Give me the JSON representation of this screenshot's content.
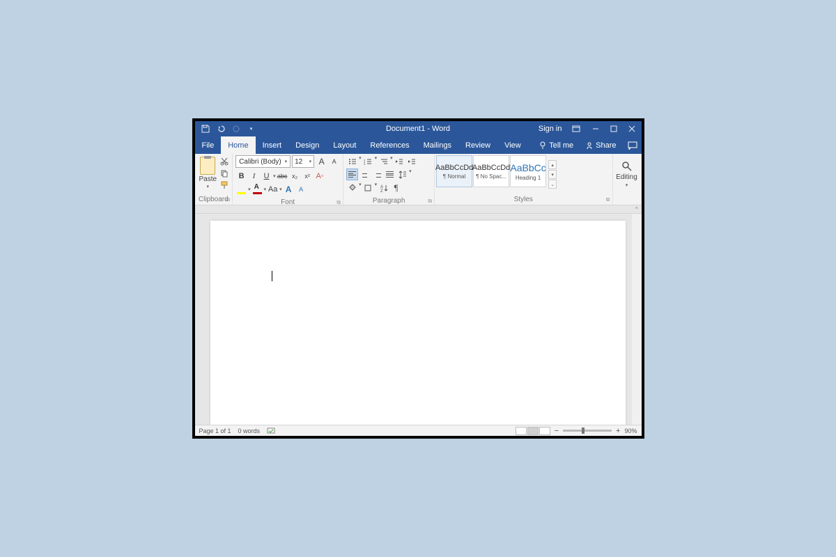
{
  "title": "Document1 - Word",
  "signin": "Sign in",
  "tabs": {
    "file": "File",
    "home": "Home",
    "insert": "Insert",
    "design": "Design",
    "layout": "Layout",
    "references": "References",
    "mailings": "Mailings",
    "review": "Review",
    "view": "View"
  },
  "tellme": "Tell me",
  "share": "Share",
  "clipboard": {
    "paste": "Paste",
    "label": "Clipboard"
  },
  "font": {
    "name": "Calibri (Body)",
    "size": "12",
    "label": "Font",
    "aa": "Aa",
    "agrow": "A",
    "ashrink": "A",
    "b": "B",
    "i": "I",
    "u": "U",
    "strike": "abc",
    "sub": "x₂",
    "sup": "x²"
  },
  "paragraph": {
    "label": "Paragraph"
  },
  "styles": {
    "label": "Styles",
    "sample": "AaBbCcDd",
    "sample_big": "AaBbCc",
    "s1": "¶ Normal",
    "s2": "¶ No Spac...",
    "s3": "Heading 1"
  },
  "editing": {
    "label": "Editing"
  },
  "status": {
    "page": "Page 1 of 1",
    "words": "0 words",
    "zoom": "90%"
  }
}
